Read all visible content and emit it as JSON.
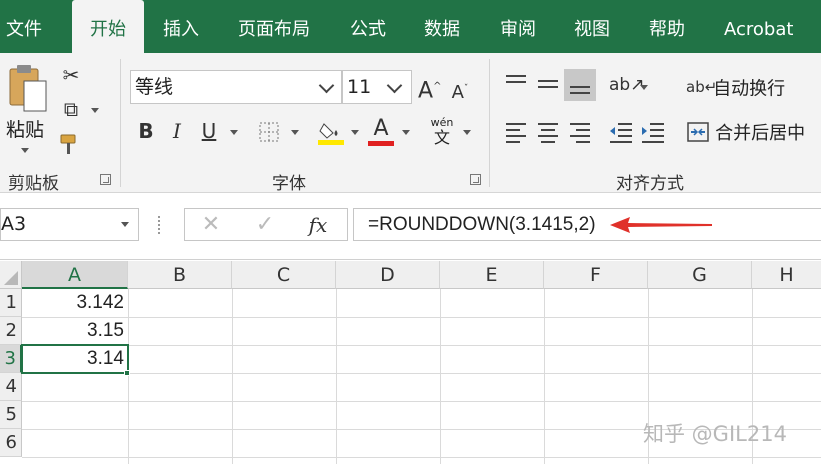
{
  "ribbon_tabs": [
    "文件",
    "开始",
    "插入",
    "页面布局",
    "公式",
    "数据",
    "审阅",
    "视图",
    "帮助",
    "Acrobat"
  ],
  "active_tab": "开始",
  "clipboard": {
    "paste_label": "粘贴",
    "group_label": "剪贴板"
  },
  "font": {
    "name": "等线",
    "size": "11",
    "group_label": "字体",
    "phonetic_label": "wén",
    "phonetic_char": "文"
  },
  "alignment": {
    "wrap_text": "自动换行",
    "merge_center": "合并后居中",
    "group_label": "对齐方式"
  },
  "formula_bar": {
    "name_box": "A3",
    "formula": "=ROUNDDOWN(3.1415,2)",
    "fx": "fx"
  },
  "sheet": {
    "columns": [
      "A",
      "B",
      "C",
      "D",
      "E",
      "F",
      "G",
      "H"
    ],
    "rows": [
      "1",
      "2",
      "3",
      "4",
      "5",
      "6"
    ],
    "cells": {
      "A1": "3.142",
      "A2": "3.15",
      "A3": "3.14"
    },
    "active_cell": "A3"
  },
  "watermark": "知乎 @GIL214",
  "colors": {
    "accent": "#217346",
    "arrow": "#e0312a",
    "font_underline": "#e02020",
    "highlight": "#ffe800"
  },
  "icons": [
    "cut-icon",
    "copy-icon",
    "format-painter-icon",
    "paste-icon",
    "increase-font-icon",
    "decrease-font-icon",
    "bold-icon",
    "italic-icon",
    "underline-icon",
    "border-icon",
    "fill-color-icon",
    "font-color-icon",
    "phonetic-icon",
    "align-top-icon",
    "align-middle-icon",
    "align-bottom-icon",
    "orientation-icon",
    "align-left-icon",
    "center-icon",
    "align-right-icon",
    "decrease-indent-icon",
    "increase-indent-icon",
    "wrap-text-icon",
    "merge-icon",
    "cancel-icon",
    "enter-icon",
    "fx-icon",
    "arrow-annotation"
  ]
}
